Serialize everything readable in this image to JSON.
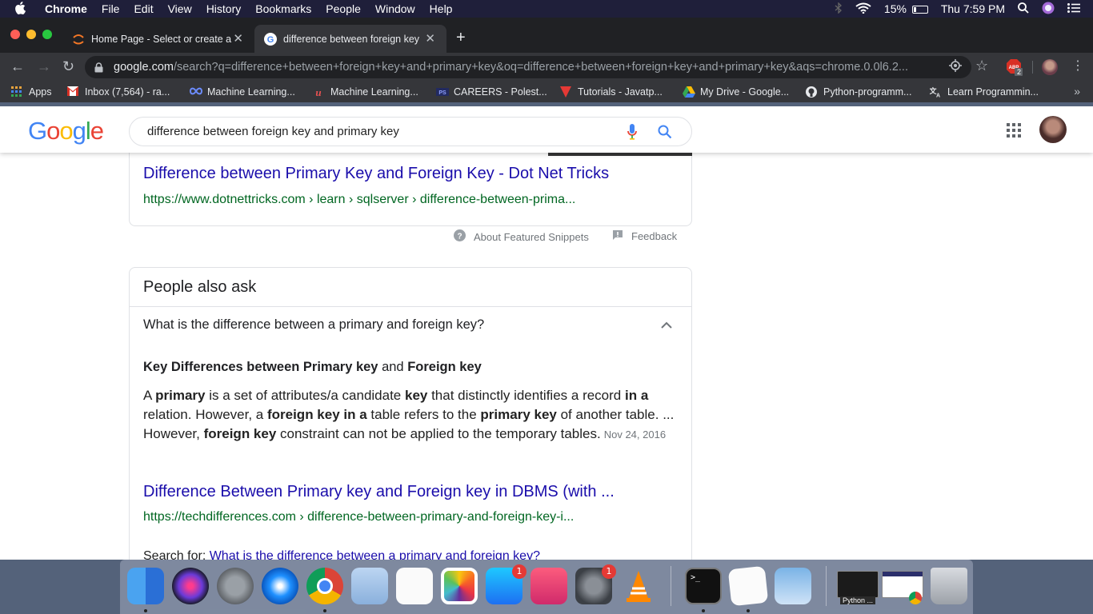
{
  "menubar": {
    "app": "Chrome",
    "items": [
      "File",
      "Edit",
      "View",
      "History",
      "Bookmarks",
      "People",
      "Window",
      "Help"
    ],
    "battery": "15%",
    "clock": "Thu 7:59 PM"
  },
  "tabs": [
    {
      "title": "Home Page - Select or create a",
      "active": false
    },
    {
      "title": "difference between foreign key",
      "active": true
    }
  ],
  "omnibox": {
    "domain": "google.com",
    "path": "/search?q=difference+between+foreign+key+and+primary+key&oq=difference+between+foreign+key+and+primary+key&aqs=chrome.0.0l6.2..."
  },
  "extension_badge": "2",
  "bookmarks": [
    "Apps",
    "Inbox (7,564) - ra...",
    "Machine Learning...",
    "Machine Learning...",
    "CAREERS - Polest...",
    "Tutorials - Javatp...",
    "My Drive - Google...",
    "Python-programm...",
    "Learn Programmin..."
  ],
  "google": {
    "logo_letters": [
      "G",
      "o",
      "o",
      "g",
      "l",
      "e"
    ],
    "logo_colors": [
      "#4285F4",
      "#EA4335",
      "#FBBC05",
      "#4285F4",
      "#34A853",
      "#EA4335"
    ],
    "query": "difference between foreign key and primary key"
  },
  "snippet_result": {
    "title": "Difference between Primary Key and Foreign Key - Dot Net Tricks",
    "url": "https://www.dotnettricks.com › learn › sqlserver › difference-between-prima..."
  },
  "snippet_footer": {
    "about": "About Featured Snippets",
    "feedback": "Feedback"
  },
  "paa": {
    "title": "People also ask",
    "question": "What is the difference between a primary and foreign key?",
    "answer_heading": [
      {
        "t": "Key Differences between Primary key",
        "b": true
      },
      {
        "t": " and ",
        "b": false
      },
      {
        "t": "Foreign key",
        "b": true
      }
    ],
    "answer_body": [
      {
        "t": "A ",
        "b": false
      },
      {
        "t": "primary",
        "b": true
      },
      {
        "t": " is a set of attributes/a candidate ",
        "b": false
      },
      {
        "t": "key",
        "b": true
      },
      {
        "t": " that distinctly identifies a record ",
        "b": false
      },
      {
        "t": "in a",
        "b": true
      },
      {
        "t": " relation. However, a ",
        "b": false
      },
      {
        "t": "foreign key in a",
        "b": true
      },
      {
        "t": " table refers to the ",
        "b": false
      },
      {
        "t": "primary key",
        "b": true
      },
      {
        "t": " of another table. ... However, ",
        "b": false
      },
      {
        "t": "foreign key",
        "b": true
      },
      {
        "t": " constraint can not be applied to the temporary tables.",
        "b": false
      }
    ],
    "answer_date": "Nov 24, 2016",
    "result_title": "Difference Between Primary key and Foreign key in DBMS (with ...",
    "result_url": "https://techdifferences.com › difference-between-primary-and-foreign-key-i...",
    "search_for_label": "Search for: ",
    "search_for_link": "What is the difference between a primary and foreign key?"
  },
  "dock": {
    "badges": [
      "1",
      "1"
    ],
    "caption": "Python ..."
  }
}
